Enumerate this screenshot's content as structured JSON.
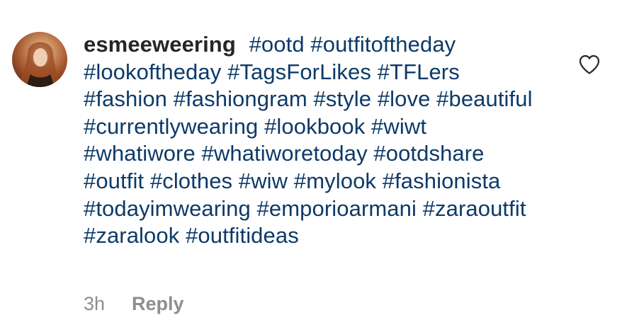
{
  "comment": {
    "username": "esmeeweering",
    "hashtags": [
      "#ootd",
      "#outfitoftheday",
      "#lookoftheday",
      "#TagsForLikes",
      "#TFLers",
      "#fashion",
      "#fashiongram",
      "#style",
      "#love",
      "#beautiful",
      "#currentlywearing",
      "#lookbook",
      "#wiwt",
      "#whatiwore",
      "#whatiworetoday",
      "#ootdshare",
      "#outfit",
      "#clothes",
      "#wiw",
      "#mylook",
      "#fashionista",
      "#todayimwearing",
      "#emporioarmani",
      "#zaraoutfit",
      "#zaralook",
      "#outfitideas"
    ],
    "time": "3h",
    "reply_label": "Reply"
  },
  "icons": {
    "like": "heart-outline-icon",
    "avatar": "user-avatar"
  },
  "colors": {
    "hashtag": "#0d3a68",
    "username": "#262626",
    "meta": "#8e8e8e",
    "background": "#ffffff"
  }
}
